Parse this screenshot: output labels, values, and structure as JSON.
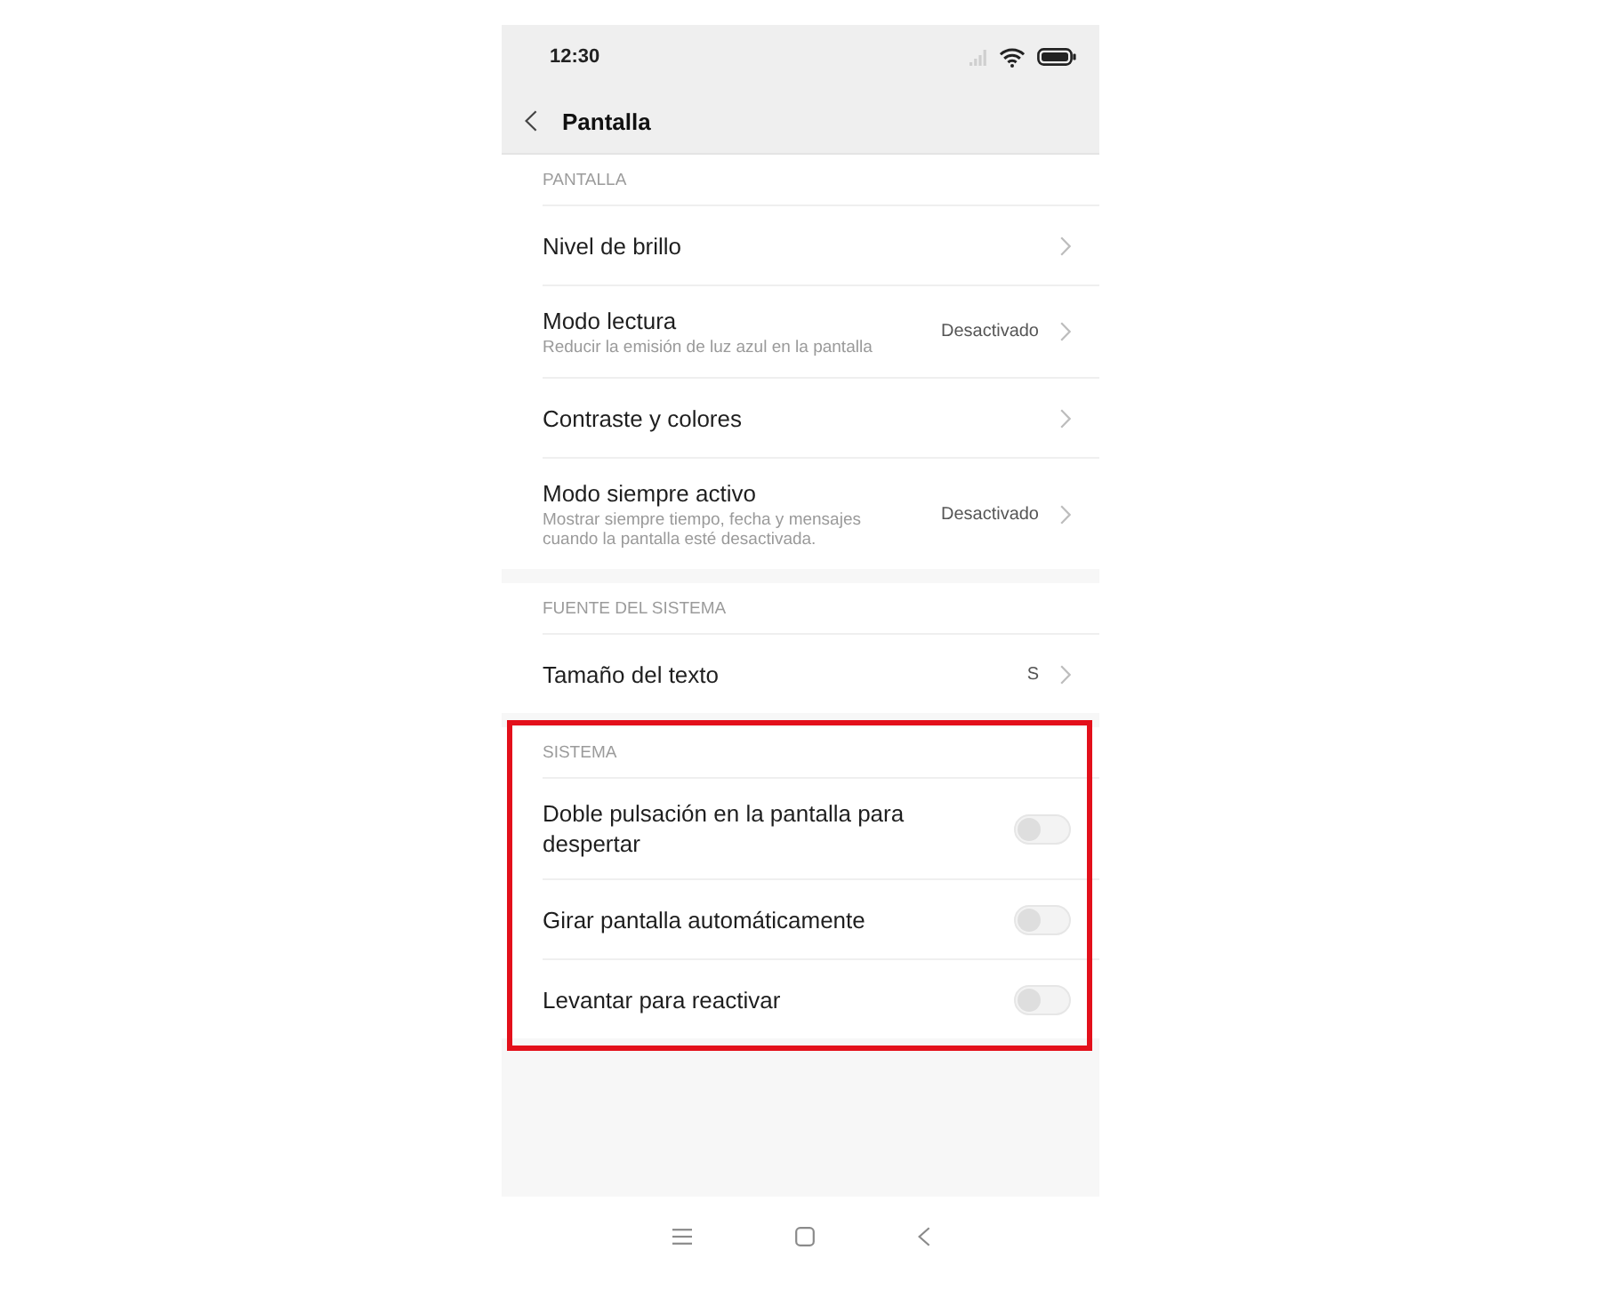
{
  "status_bar": {
    "time": "12:30"
  },
  "header": {
    "title": "Pantalla"
  },
  "sections": [
    {
      "title": "PANTALLA",
      "highlighted": false,
      "rows": [
        {
          "kind": "link",
          "title": "Nivel de brillo"
        },
        {
          "kind": "link",
          "title": "Modo lectura",
          "description": "Reducir la emisión de luz azul en la pantalla",
          "value": "Desactivado"
        },
        {
          "kind": "link",
          "title": "Contraste y colores"
        },
        {
          "kind": "link",
          "title": "Modo siempre activo",
          "description": "Mostrar siempre tiempo, fecha y mensajes cuando la pantalla esté desactivada.",
          "value": "Desactivado"
        }
      ]
    },
    {
      "title": "FUENTE DEL SISTEMA",
      "highlighted": false,
      "rows": [
        {
          "kind": "link",
          "title": "Tamaño del texto",
          "value": "S"
        }
      ]
    },
    {
      "title": "SISTEMA",
      "highlighted": true,
      "rows": [
        {
          "kind": "switch",
          "title": "Doble pulsación en la pantalla para despertar",
          "on": false
        },
        {
          "kind": "switch",
          "title": "Girar pantalla automáticamente",
          "on": false
        },
        {
          "kind": "switch",
          "title": "Levantar para reactivar",
          "on": false
        }
      ]
    }
  ]
}
